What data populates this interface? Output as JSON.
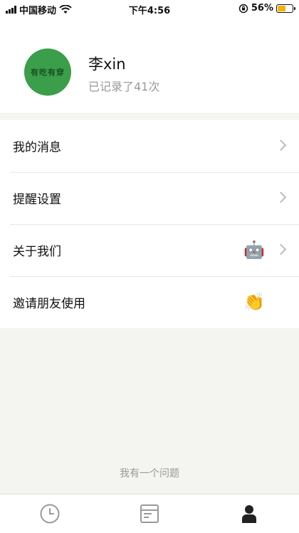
{
  "status_bar": {
    "carrier": "中国移动",
    "time": "下午4:56",
    "battery_percent": "56%",
    "battery_level": 0.56,
    "icons": [
      "signal-icon",
      "wifi-icon",
      "orientation-lock-icon",
      "battery-icon"
    ]
  },
  "capsule": {
    "icons": [
      "more-dots-icon",
      "close-target-icon"
    ]
  },
  "profile": {
    "avatar_text": "有吃有穿",
    "name": "李xin",
    "subtitle": "已记录了41次",
    "avatar_color": "#3a9e4a"
  },
  "menu": {
    "items": [
      {
        "label": "我的消息"
      },
      {
        "label": "提醒设置"
      },
      {
        "label": "关于我们",
        "emoji": "🤖"
      },
      {
        "label": "邀请朋友使用",
        "emoji": "👏"
      }
    ]
  },
  "footer": {
    "link": "我有一个问题"
  },
  "tabbar": {
    "tabs": [
      {
        "icon": "clock-icon"
      },
      {
        "icon": "browser-window-icon"
      },
      {
        "icon": "person-icon",
        "active": true
      }
    ],
    "inactive_color": "#999999",
    "active_color": "#222222"
  }
}
